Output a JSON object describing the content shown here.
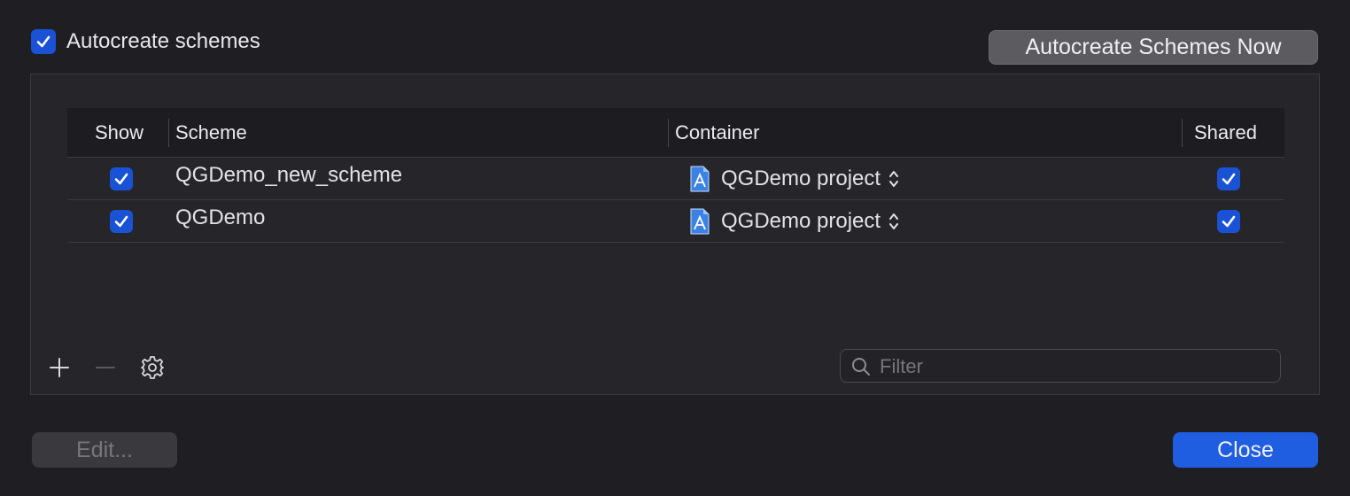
{
  "header": {
    "autocreate_label": "Autocreate schemes",
    "autocreate_checked": true,
    "autocreate_now_label": "Autocreate Schemes Now"
  },
  "table": {
    "columns": [
      "Show",
      "Scheme",
      "Container",
      "Shared"
    ],
    "rows": [
      {
        "show": true,
        "scheme": "QGDemo_new_scheme",
        "container": "QGDemo project",
        "shared": true
      },
      {
        "show": true,
        "scheme": "QGDemo",
        "container": "QGDemo project",
        "shared": true
      }
    ]
  },
  "filter": {
    "placeholder": "Filter",
    "value": ""
  },
  "footer": {
    "edit_label": "Edit...",
    "close_label": "Close"
  },
  "icons": {
    "add": "plus-icon",
    "remove": "minus-icon",
    "settings": "gear-icon",
    "search": "magnifier-icon",
    "project": "xcode-project-icon",
    "popup": "up-down-chevron-icon"
  },
  "colors": {
    "accent": "#1f5ee0",
    "checkbox": "#1a52d6",
    "background": "#1f1e23"
  }
}
